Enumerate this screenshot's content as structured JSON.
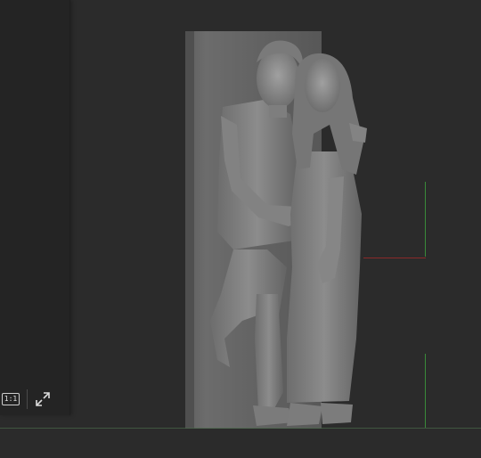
{
  "toolbar": {
    "ratio_label": "1:1",
    "icons": [
      "aspect-ratio-icon",
      "expand-icon"
    ]
  },
  "viewport": {
    "background": "#2b2b2b",
    "model_color": "#7a7a7a",
    "axis_colors": {
      "x": "#8a2a2a",
      "y": "#3a8a3a"
    }
  }
}
